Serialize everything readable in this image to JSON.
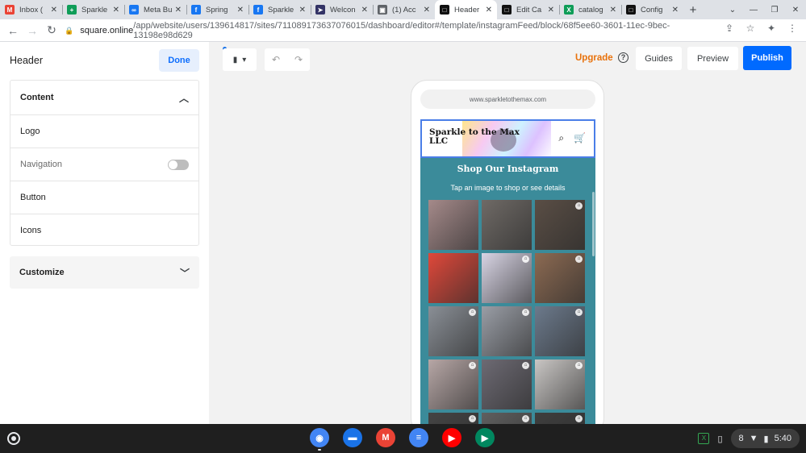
{
  "tabs": [
    {
      "title": "Inbox (",
      "favicon": "gmail-icon",
      "color": "#ea4335",
      "glyph": "M"
    },
    {
      "title": "Sparkle",
      "favicon": "sheets-icon",
      "color": "#0f9d58",
      "glyph": "+"
    },
    {
      "title": "Meta Bu",
      "favicon": "meta-icon",
      "color": "#1877f2",
      "glyph": "∞"
    },
    {
      "title": "Spring",
      "favicon": "facebook-icon",
      "color": "#1877f2",
      "glyph": "f"
    },
    {
      "title": "Sparkle",
      "favicon": "facebook-icon",
      "color": "#1877f2",
      "glyph": "f"
    },
    {
      "title": "Welcon",
      "favicon": "usps-icon",
      "color": "#333366",
      "glyph": "➤"
    },
    {
      "title": "(1) Acc",
      "favicon": "page-icon",
      "color": "#5f6368",
      "glyph": "▣"
    },
    {
      "title": "Header",
      "favicon": "square-icon",
      "color": "#111111",
      "glyph": "□",
      "active": true
    },
    {
      "title": "Edit Ca",
      "favicon": "square-icon",
      "color": "#111111",
      "glyph": "□"
    },
    {
      "title": "catalog",
      "favicon": "x-icon",
      "color": "#0f9d58",
      "glyph": "X"
    },
    {
      "title": "Config",
      "favicon": "square-icon",
      "color": "#111111",
      "glyph": "□"
    }
  ],
  "address": {
    "host": "square.online",
    "path": "/app/website/users/139614817/sites/711089173637076015/dashboard/editor#/template/instagramFeed/block/68f5ee60-3601-11ec-9bec-13198e98d629"
  },
  "panel": {
    "title": "Header",
    "done_label": "Done",
    "content_label": "Content",
    "rows": [
      "Logo",
      "Navigation",
      "Button",
      "Icons"
    ],
    "customize_label": "Customize"
  },
  "top_actions": {
    "upgrade": "Upgrade",
    "help": "?",
    "guides": "Guides",
    "preview": "Preview",
    "publish": "Publish"
  },
  "preview": {
    "url": "www.sparkletothemax.com",
    "brand": "Sparkle to the Max LLC",
    "ig_title": "Shop Our Instagram",
    "ig_sub": "Tap an image to shop or see details"
  },
  "grid_colors": [
    "#a58a8a",
    "#6f6a66",
    "#5a4e45",
    "#e0483a",
    "#d8d4e4",
    "#8c6a52",
    "#8a8f96",
    "#9a9ea6",
    "#6c7a8c",
    "#b7a7a6",
    "#6d6a73",
    "#c9c6c4",
    "#444444",
    "#5f5f5f",
    "#3e3e3e"
  ],
  "shelf": {
    "apps": [
      {
        "name": "chrome-icon",
        "color": "#4285f4",
        "glyph": "◉",
        "running": true
      },
      {
        "name": "files-icon",
        "color": "#1a73e8",
        "glyph": "▬",
        "running": false
      },
      {
        "name": "gmail-app-icon",
        "color": "#ea4335",
        "glyph": "M",
        "running": false
      },
      {
        "name": "docs-icon",
        "color": "#4285f4",
        "glyph": "≡",
        "running": false
      },
      {
        "name": "youtube-icon",
        "color": "#ff0000",
        "glyph": "▶",
        "running": false
      },
      {
        "name": "play-store-icon",
        "color": "#01875f",
        "glyph": "▶",
        "running": false
      }
    ],
    "tray_badge": "8",
    "time": "5:40"
  }
}
